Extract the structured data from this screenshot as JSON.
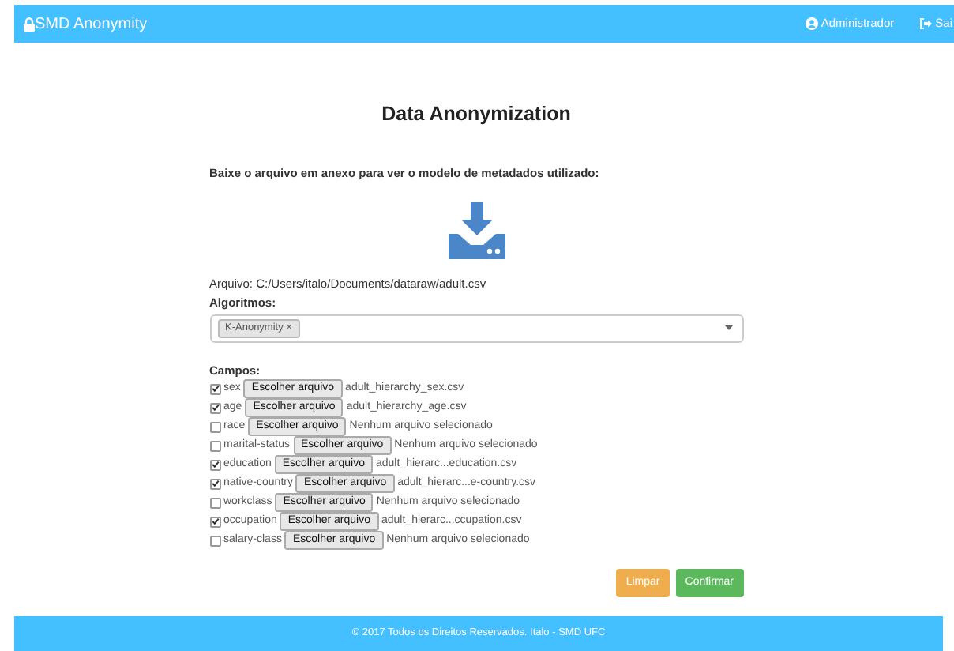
{
  "navbar": {
    "brand": "SMD Anonymity",
    "links": [
      {
        "label": "Administrador",
        "kind": "user"
      },
      {
        "label": "Sai",
        "kind": "logout"
      }
    ]
  },
  "title": "Data Anonymization",
  "download_prompt": "Baixe o arquivo em anexo para ver o modelo de metadados utilizado:",
  "file_path": "Arquivo: C:/Users/italo/Documents/dataraw/adult.csv",
  "algorithms": {
    "label": "Algoritmos:",
    "tags": [
      {
        "label": "K-Anonymity",
        "remove": "×"
      }
    ]
  },
  "fields": {
    "label": "Campos:",
    "items": [
      {
        "name": "sex",
        "checked": true,
        "button": "Escolher arquivo",
        "file": "adult_hierarchy_sex.csv"
      },
      {
        "name": "age",
        "checked": true,
        "button": "Escolher arquivo",
        "file": "adult_hierarchy_age.csv"
      },
      {
        "name": "race",
        "checked": false,
        "button": "Escolher arquivo",
        "file": "Nenhum arquivo selecionado"
      },
      {
        "name": "marital-status",
        "checked": false,
        "button": "Escolher arquivo",
        "file": "Nenhum arquivo selecionado"
      },
      {
        "name": "education",
        "checked": true,
        "button": "Escolher arquivo",
        "file": "adult_hierarc...education.csv"
      },
      {
        "name": "native-country",
        "checked": true,
        "button": "Escolher arquivo",
        "file": "adult_hierarc...e-country.csv"
      },
      {
        "name": "workclass",
        "checked": false,
        "button": "Escolher arquivo",
        "file": "Nenhum arquivo selecionado"
      },
      {
        "name": "occupation",
        "checked": true,
        "button": "Escolher arquivo",
        "file": "adult_hierarc...ccupation.csv"
      },
      {
        "name": "salary-class",
        "checked": false,
        "button": "Escolher arquivo",
        "file": "Nenhum arquivo selecionado"
      }
    ]
  },
  "buttons": [
    {
      "label": "Limpar",
      "kind": "warning"
    },
    {
      "label": "Confirmar",
      "kind": "success"
    }
  ],
  "footer": "© 2017 Todos os Direitos Reservados. Italo - SMD UFC"
}
